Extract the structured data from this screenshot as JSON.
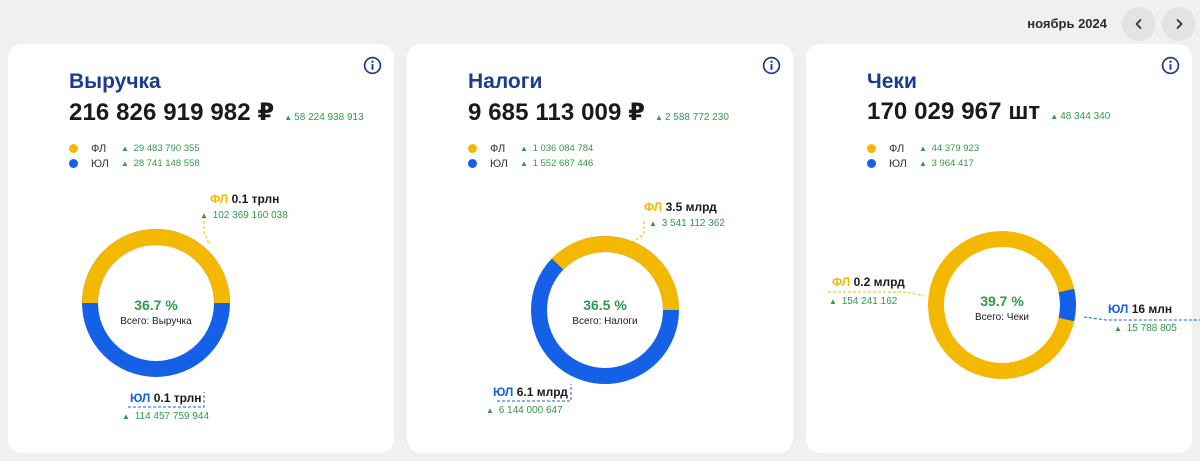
{
  "header": {
    "period_label": "ноябрь 2024"
  },
  "colors": {
    "fl": "#f5b800",
    "ul": "#1460e6",
    "positive": "#2e9a4a",
    "title": "#1a3b8f"
  },
  "cards": [
    {
      "title": "Выручка",
      "total": "216 826 919 982 ₽",
      "total_delta": "58 224 938 913",
      "legend": [
        {
          "name": "ФЛ",
          "delta": "29 483 790 355"
        },
        {
          "name": "ЮЛ",
          "delta": "28 741 148 558"
        }
      ],
      "center_pct": "36.7 %",
      "center_label": "Всего: Выручка",
      "fl_value": "0.1 трлн",
      "fl_delta": "102 369 160 038",
      "ul_value": "0.1 трлн",
      "ul_delta": "114 457 759 944"
    },
    {
      "title": "Налоги",
      "total": "9 685 113 009 ₽",
      "total_delta": "2 588 772 230",
      "legend": [
        {
          "name": "ФЛ",
          "delta": "1 036 084 784"
        },
        {
          "name": "ЮЛ",
          "delta": "1 552 687 446"
        }
      ],
      "center_pct": "36.5 %",
      "center_label": "Всего: Налоги",
      "fl_value": "3.5 млрд",
      "fl_delta": "3 541 112 362",
      "ul_value": "6.1 млрд",
      "ul_delta": "6 144 000 647"
    },
    {
      "title": "Чеки",
      "total": "170 029 967 шт",
      "total_delta": "48 344 340",
      "legend": [
        {
          "name": "ФЛ",
          "delta": "44 379 923"
        },
        {
          "name": "ЮЛ",
          "delta": "3 964 417"
        }
      ],
      "center_pct": "39.7 %",
      "center_label": "Всего: Чеки",
      "fl_value": "0.2 млрд",
      "fl_delta": "154 241 162",
      "ul_value": "16 млн",
      "ul_delta": "15 788 805"
    }
  ]
}
